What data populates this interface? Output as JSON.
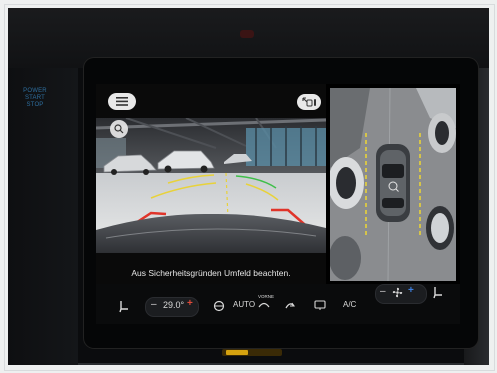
{
  "console": {
    "power_line1": "POWER",
    "power_line2": "START",
    "power_line3": "STOP"
  },
  "camera": {
    "notice": "Aus Sicherheitsgründen Umfeld beachten."
  },
  "climate": {
    "minus": "–",
    "temperature": "29.0°",
    "plus": "+",
    "auto_label": "AUTO",
    "vorne_label": "VORNE",
    "ac_label": "A/C",
    "fan_minus": "–",
    "fan_plus": "+"
  },
  "colors": {
    "guide_red": "#e0342a",
    "guide_green": "#3fbf4a",
    "guide_yellow": "#e8d23a",
    "temp_plus": "#e04a3a",
    "fan_plus": "#3d7fe0"
  }
}
